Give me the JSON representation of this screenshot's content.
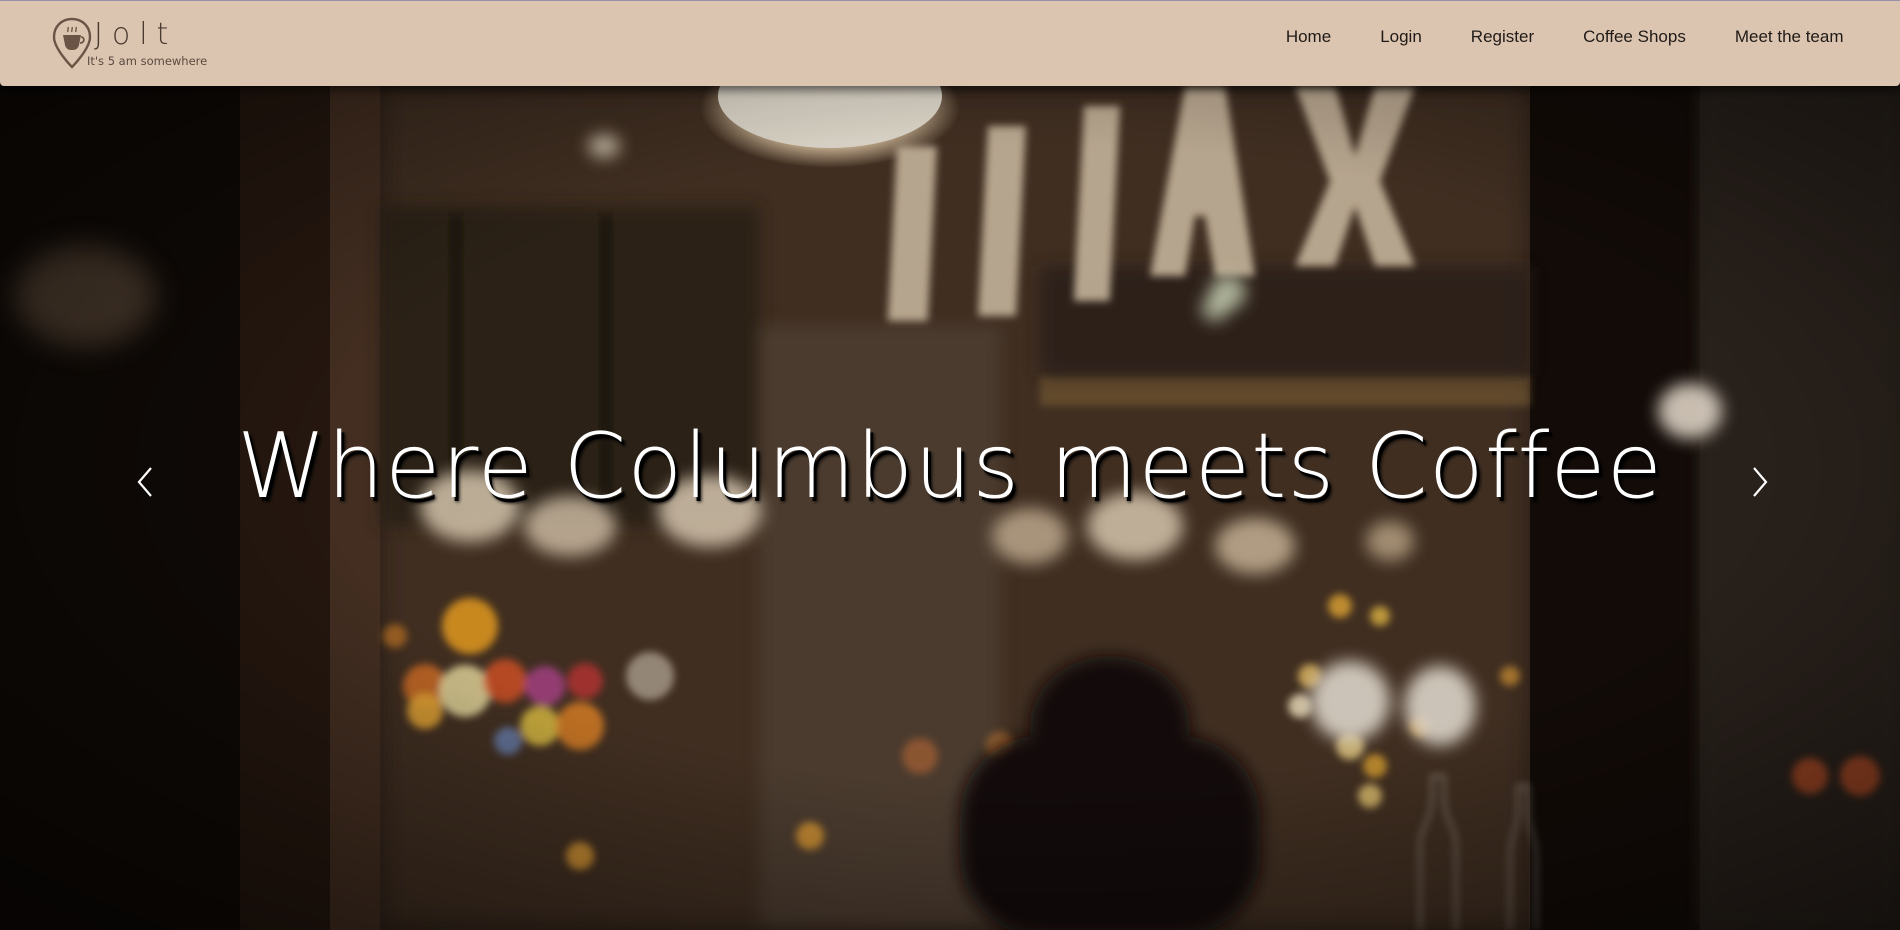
{
  "brand": {
    "name": "Jolt",
    "tagline": "It's 5 am somewhere",
    "icon": "map-pin-coffee-icon"
  },
  "nav": {
    "items": [
      {
        "label": "Home"
      },
      {
        "label": "Login"
      },
      {
        "label": "Register"
      },
      {
        "label": "Coffee Shops"
      },
      {
        "label": "Meet the team"
      }
    ]
  },
  "hero": {
    "caption": "Where Columbus meets Coffee",
    "sign_text": "RELAX",
    "prev_icon": "chevron-left-icon",
    "next_icon": "chevron-right-icon"
  },
  "colors": {
    "navbar_bg": "#dcc5b0",
    "nav_text": "#1f1a17",
    "brand_text": "#4a3a30",
    "caption_text": "#ffffff"
  }
}
